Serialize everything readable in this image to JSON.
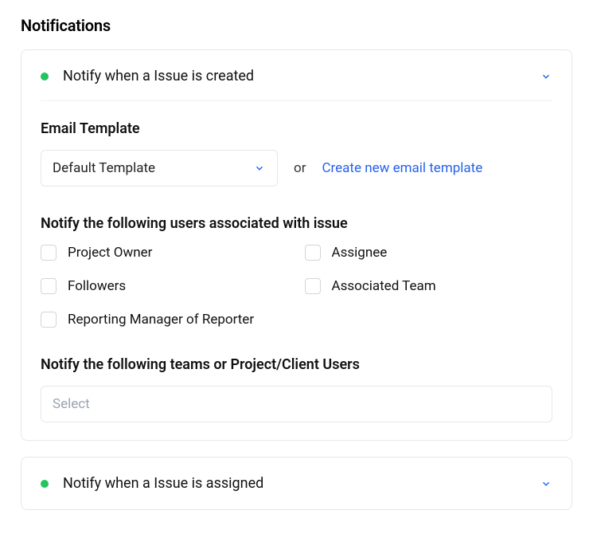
{
  "page_title": "Notifications",
  "colors": {
    "status_active": "#22c55e",
    "accent": "#2563eb"
  },
  "sections": [
    {
      "title": "Notify when a Issue is created",
      "expanded": true,
      "email_template": {
        "label": "Email Template",
        "selected": "Default Template",
        "or_text": "or",
        "create_link": "Create new email template"
      },
      "users_section": {
        "label": "Notify the following users associated with issue",
        "options": [
          {
            "label": "Project Owner",
            "checked": false
          },
          {
            "label": "Assignee",
            "checked": false
          },
          {
            "label": "Followers",
            "checked": false
          },
          {
            "label": "Associated Team",
            "checked": false
          },
          {
            "label": "Reporting Manager of Reporter",
            "checked": false
          }
        ]
      },
      "teams_section": {
        "label": "Notify the following teams or Project/Client Users",
        "placeholder": "Select"
      }
    },
    {
      "title": "Notify when a Issue is assigned",
      "expanded": false
    }
  ]
}
